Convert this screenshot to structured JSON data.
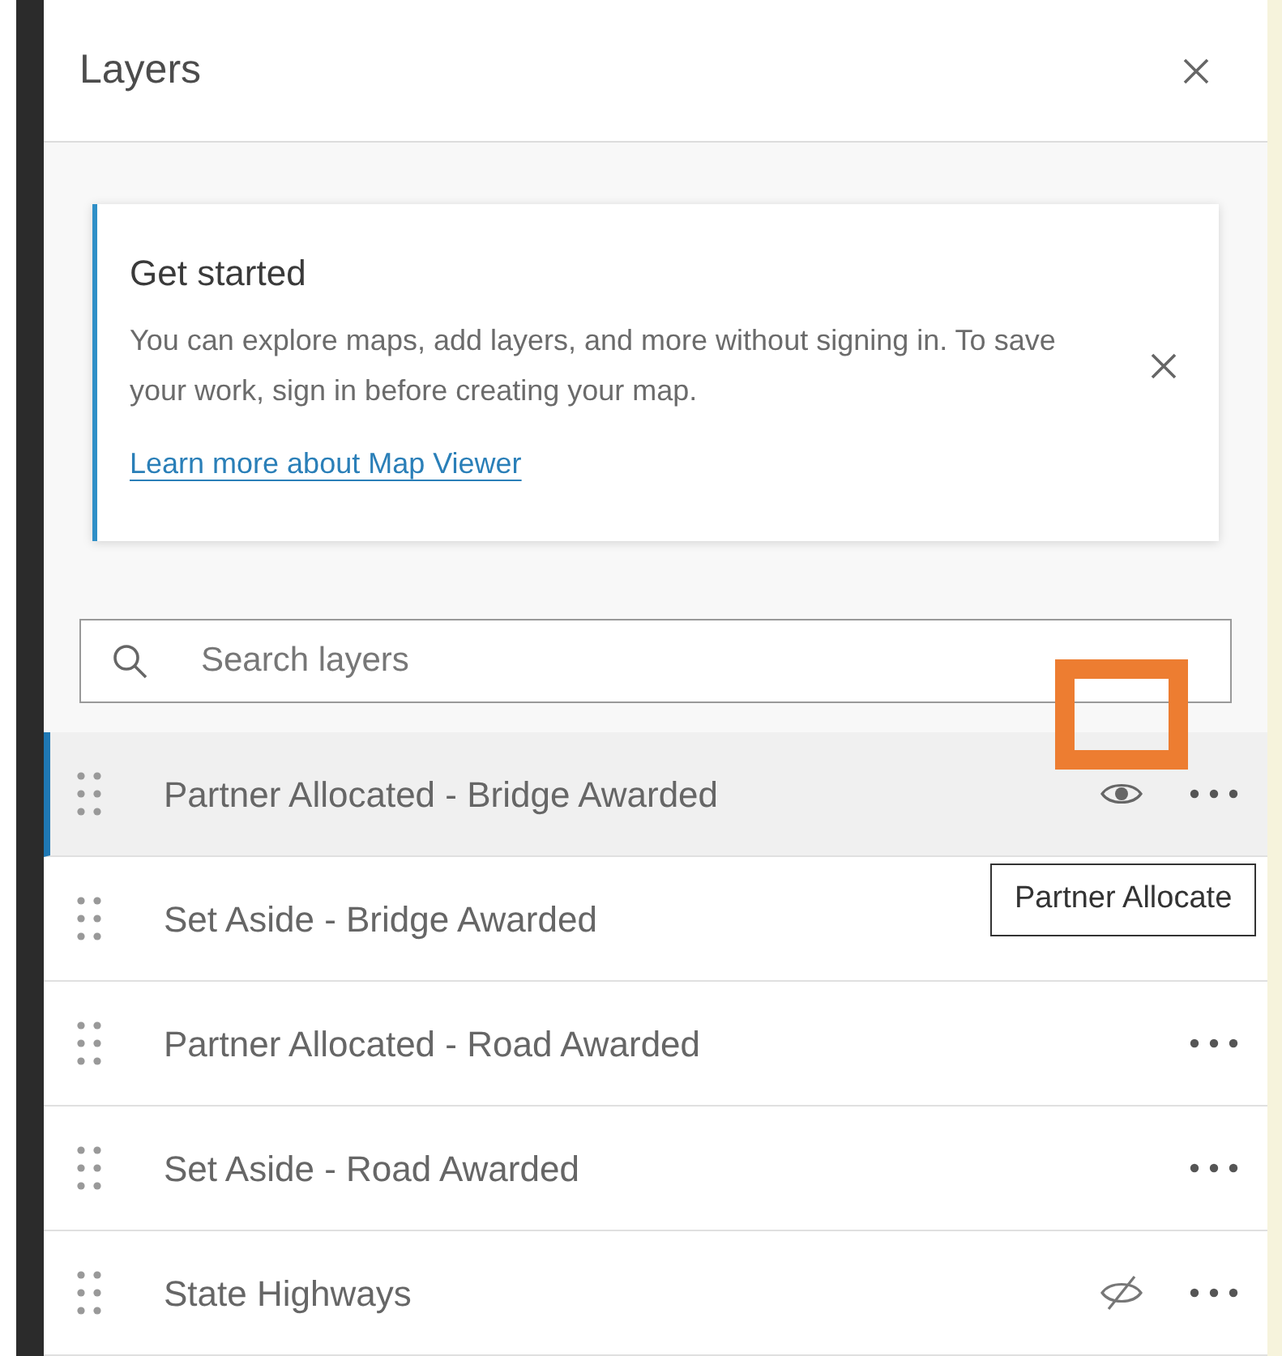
{
  "panel": {
    "title": "Layers"
  },
  "notice": {
    "title": "Get started",
    "body": "You can explore maps, add layers, and more without signing in. To save your work, sign in before creating your map.",
    "link": "Learn more about Map Viewer"
  },
  "search": {
    "placeholder": "Search layers"
  },
  "layers": [
    {
      "name": "Partner Allocated - Bridge Awarded",
      "selected": true,
      "visible": true
    },
    {
      "name": "Set Aside - Bridge Awarded",
      "selected": false
    },
    {
      "name": "Partner Allocated - Road Awarded",
      "selected": false
    },
    {
      "name": "Set Aside - Road Awarded",
      "selected": false
    },
    {
      "name": "State Highways",
      "selected": false,
      "visible": false
    }
  ],
  "tooltip": {
    "text": "Partner Allocate"
  }
}
